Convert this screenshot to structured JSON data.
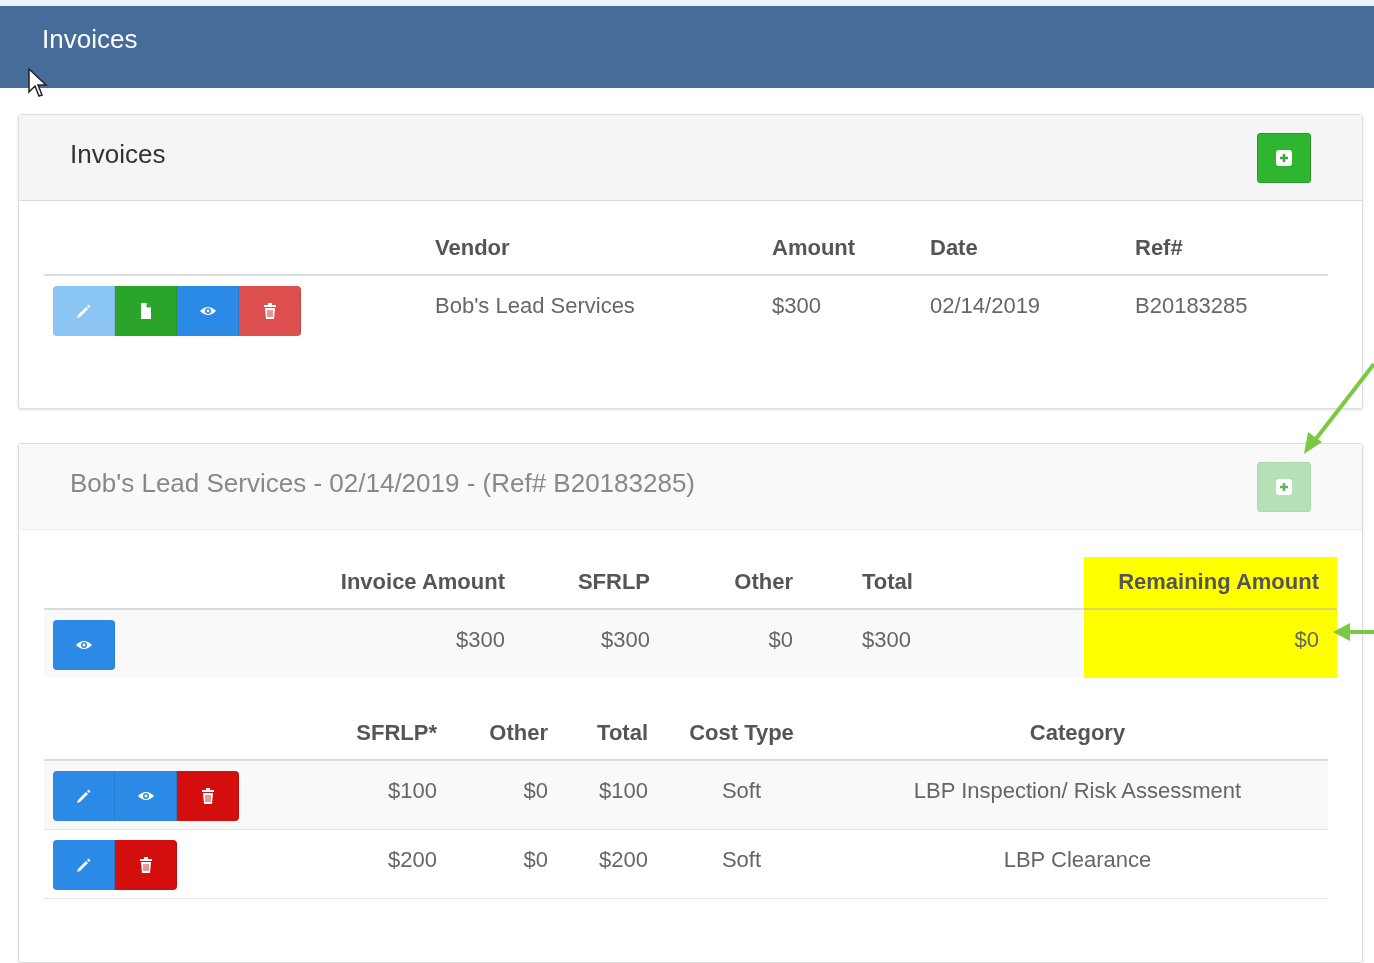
{
  "header": {
    "title": "Invoices"
  },
  "invoices_panel": {
    "title": "Invoices",
    "add_button": {
      "disabled": false
    },
    "columns": [
      "Vendor",
      "Amount",
      "Date",
      "Ref#"
    ],
    "rows": [
      {
        "actions": [
          {
            "kind": "edit",
            "disabled": true
          },
          {
            "kind": "document",
            "disabled": false
          },
          {
            "kind": "view",
            "disabled": false
          },
          {
            "kind": "delete",
            "disabled": false
          }
        ],
        "cells": [
          "Bob's Lead Services",
          "$300",
          "02/14/2019",
          "B20183285"
        ]
      }
    ]
  },
  "detail_panel": {
    "title": "Bob's Lead Services - 02/14/2019 - (Ref# B20183285)",
    "add_button": {
      "disabled": true
    },
    "summary": {
      "columns": [
        "Invoice Amount",
        "SFRLP",
        "Other",
        "Total",
        "Remaining Amount"
      ],
      "rows": [
        {
          "actions": [
            {
              "kind": "view",
              "disabled": false
            }
          ],
          "cells": [
            "$300",
            "$300",
            "$0",
            "$300",
            "$0"
          ]
        }
      ]
    },
    "items": {
      "columns": [
        "SFRLP*",
        "Other",
        "Total",
        "Cost Type",
        "Category"
      ],
      "rows": [
        {
          "actions": [
            {
              "kind": "edit",
              "disabled": false
            },
            {
              "kind": "view",
              "disabled": false
            },
            {
              "kind": "delete",
              "disabled": false
            }
          ],
          "cells": [
            "$100",
            "$0",
            "$100",
            "Soft",
            "LBP Inspection/ Risk Assessment"
          ]
        },
        {
          "actions": [
            {
              "kind": "edit",
              "disabled": false
            },
            {
              "kind": "delete",
              "disabled": false
            }
          ],
          "cells": [
            "$200",
            "$0",
            "$200",
            "Soft",
            "LBP Clearance"
          ]
        }
      ]
    }
  }
}
